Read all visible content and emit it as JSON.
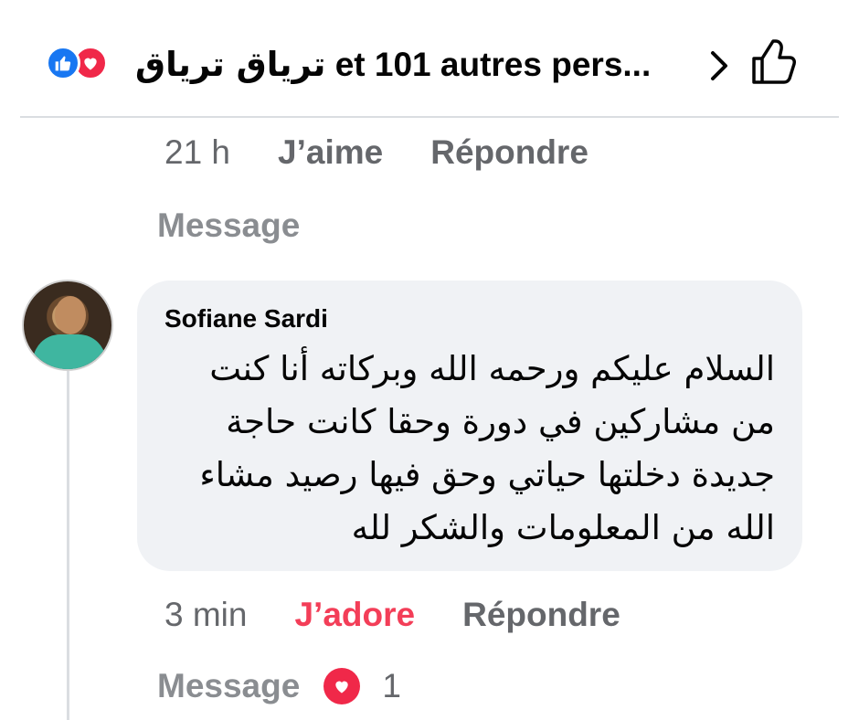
{
  "header": {
    "reactors_text": "تریاق تریاق",
    "others_text": "et 101 autres pers...",
    "icons": [
      "like-icon",
      "love-icon",
      "chevron-right-icon",
      "thumbs-up-icon"
    ],
    "colors": {
      "like": "#1877f2",
      "love": "#f02849"
    }
  },
  "previous_comment": {
    "time": "21 h",
    "like_label": "J’aime",
    "reply_label": "Répondre",
    "message_label": "Message"
  },
  "comment": {
    "author": "Sofiane Sardi",
    "text": "السلام عليكم ورحمه الله وبركاته أنا كنت من مشاركين في دورة وحقا كانت حاجة جديدة دخلتها حياتي وحق فيها رصيد مشاء الله من المعلومات والشكر لله",
    "time": "3 min",
    "reaction_label": "J’adore",
    "reaction_color": "#f33e58",
    "reply_label": "Répondre",
    "message_label": "Message",
    "love_count": "1"
  }
}
